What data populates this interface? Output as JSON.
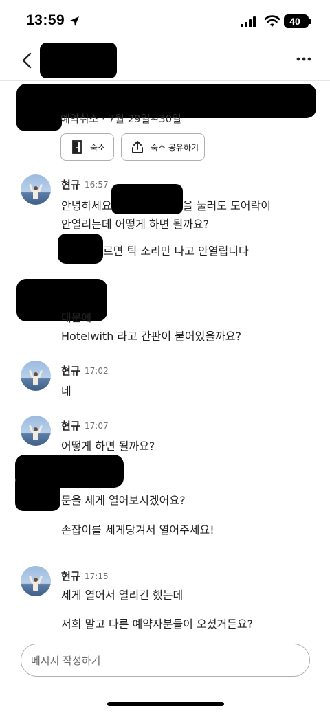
{
  "status_bar": {
    "time": "13:59",
    "battery": "40",
    "icons": [
      "location-arrow-icon",
      "cellular-signal-icon",
      "wifi-icon",
      "battery-icon"
    ]
  },
  "header": {
    "icons": [
      "chevron-left-icon",
      "more-horizontal-icon"
    ]
  },
  "reservation": {
    "status": "예약취소 · 7월 29일~30일",
    "buttons": [
      {
        "label": "숙소",
        "icon": "door-icon"
      },
      {
        "label": "숙소 공유하기",
        "icon": "share-icon"
      }
    ]
  },
  "messages": [
    {
      "sender": "현규",
      "time": "16:57",
      "lines": [
        "안녕하세요",
        "을 눌러도  도어락이",
        "안열리는데 어떻게 하면 될까요?",
        "르면 틱 소리만 나고 안열립니다"
      ]
    },
    {
      "sender": "",
      "time": "",
      "lines": [
        "대문에",
        "Hotelwith 라고 간판이 붙어있을까요?"
      ]
    },
    {
      "sender": "현규",
      "time": "17:02",
      "lines": [
        "네"
      ]
    },
    {
      "sender": "현규",
      "time": "17:07",
      "lines": [
        "어떻게 하면 될까요?"
      ]
    },
    {
      "sender": "",
      "time": "",
      "lines": [
        "문을 세게 열어보시겠어요?",
        "손잡이를 세게당겨서 열어주세요!"
      ]
    },
    {
      "sender": "현규",
      "time": "17:15",
      "lines": [
        "세게 열어서 열리긴 했는데",
        "저희 말고 다른 예약자분들이 오셨거든요?"
      ]
    }
  ],
  "compose": {
    "placeholder": "메시지 작성하기"
  }
}
